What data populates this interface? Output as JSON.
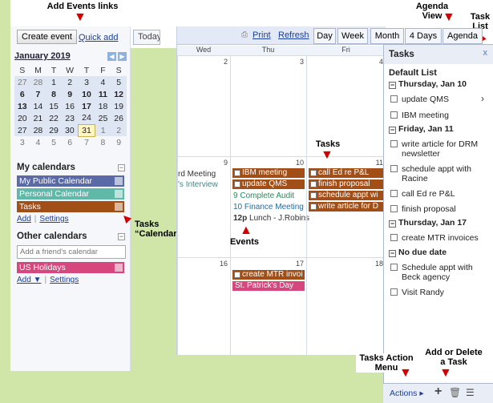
{
  "annotations": {
    "add_events": "Add Events links",
    "agenda_view": "Agenda View",
    "task_list": "Task List",
    "tasks_calendar": "Tasks “Calendar”",
    "tasks": "Tasks",
    "events": "Events",
    "tasks_action_menu": "Tasks Action Menu",
    "add_delete_task": "Add or Delete a Task"
  },
  "left": {
    "create_event": "Create event",
    "quick_add": "Quick add",
    "today": "Today",
    "mini_cal": {
      "title": "January 2019",
      "prev": "◀",
      "next": "▶",
      "dow": [
        "S",
        "M",
        "T",
        "W",
        "T",
        "F",
        "S"
      ],
      "weeks": [
        [
          "27",
          "28",
          "1",
          "2",
          "3",
          "4",
          "5"
        ],
        [
          "6",
          "7",
          "8",
          "9",
          "10",
          "11",
          "12"
        ],
        [
          "13",
          "14",
          "15",
          "16",
          "17",
          "18",
          "19"
        ],
        [
          "20",
          "21",
          "22",
          "23",
          "24",
          "25",
          "26"
        ],
        [
          "27",
          "28",
          "29",
          "30",
          "31",
          "1",
          "2"
        ],
        [
          "3",
          "4",
          "5",
          "6",
          "7",
          "8",
          "9"
        ]
      ]
    },
    "my_calendars": {
      "title": "My calendars",
      "items": [
        {
          "label": "My Public Calendar",
          "color": "#5a6aa6"
        },
        {
          "label": "Personal Calendar",
          "color": "#5fb8a8"
        },
        {
          "label": "Tasks",
          "color": "#a14f16"
        }
      ],
      "add": "Add",
      "settings": "Settings"
    },
    "other_calendars": {
      "title": "Other calendars",
      "placeholder": "Add a friend's calendar",
      "items": [
        {
          "label": "US Holidays",
          "color": "#d6477e"
        }
      ],
      "add": "Add ▼",
      "settings": "Settings"
    }
  },
  "toolbar": {
    "print": "Print",
    "refresh": "Refresh",
    "views": [
      "Day",
      "Week",
      "Month",
      "4 Days",
      "Agenda"
    ]
  },
  "grid": {
    "dow": [
      "Wed",
      "Thu",
      "Fri"
    ],
    "week1": [
      "2",
      "3",
      "4"
    ],
    "week2": [
      "9",
      "10",
      "11"
    ],
    "week3": [
      "16",
      "17",
      "18"
    ],
    "wed_text": [
      "rd Meeting",
      "'s Interview"
    ],
    "thu_tasks": [
      "IBM meeting",
      "update QMS"
    ],
    "thu_events": [
      {
        "time": "9",
        "text": "Complete Audit"
      },
      {
        "time": "10",
        "text": "Finance Meeting"
      },
      {
        "time": "12p",
        "text": "Lunch - J.Robins"
      }
    ],
    "fri_tasks": [
      "call Ed re P&L",
      "finish proposal",
      "schedule appt wi",
      "write article for D"
    ],
    "thu17_task": "create MTR invoi",
    "thu17_holiday": "St. Patrick's Day"
  },
  "task_panel": {
    "title": "Tasks",
    "close": "x",
    "list_name": "Default List",
    "groups": [
      {
        "date": "Thursday, Jan 10",
        "items": [
          "update QMS",
          "IBM meeting"
        ]
      },
      {
        "date": "Friday, Jan 11",
        "items": [
          "write article for DRM newsletter",
          "schedule appt with Racine",
          "call Ed re P&L",
          "finish proposal"
        ]
      },
      {
        "date": "Thursday, Jan 17",
        "items": [
          "create MTR invoices"
        ]
      },
      {
        "date": "No due date",
        "items": [
          "Schedule appt with Beck agency",
          "Visit Randy"
        ]
      }
    ],
    "actions": "Actions ▸",
    "add": "+",
    "trash": "🗑",
    "list_icon": "☰"
  }
}
